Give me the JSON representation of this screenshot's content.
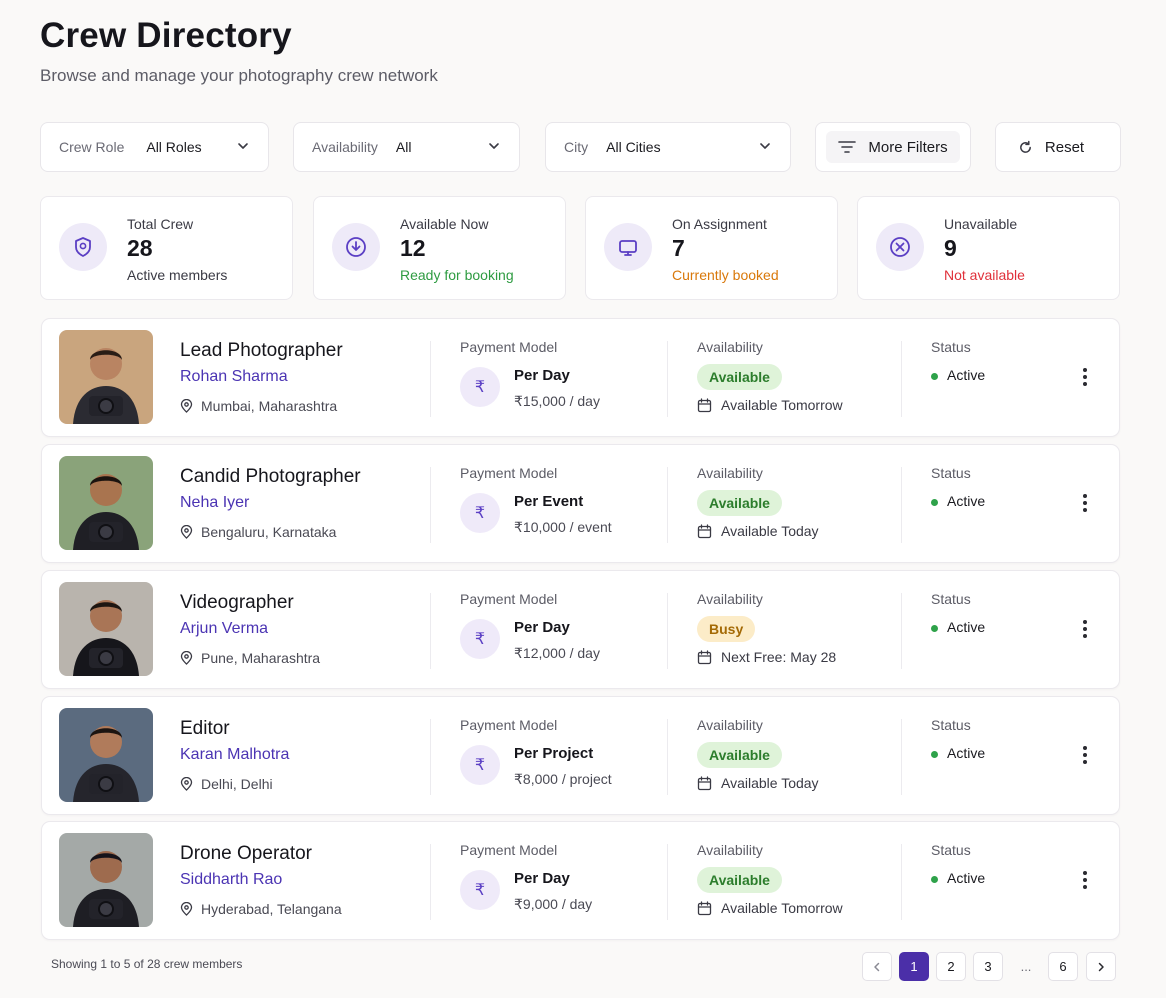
{
  "header": {
    "title": "Crew Directory",
    "subtitle": "Browse and manage your photography crew network"
  },
  "filters": {
    "role": {
      "label": "Crew Role",
      "value": "All Roles"
    },
    "availability": {
      "label": "Availability",
      "value": "All"
    },
    "city": {
      "label": "City",
      "value": "All Cities"
    },
    "more_filters_label": "More Filters",
    "reset_label": "Reset"
  },
  "stats": [
    {
      "label": "Total Crew",
      "value": "28",
      "sub": "Active members",
      "sub_color": "#3a3a44",
      "icon": "badge-icon"
    },
    {
      "label": "Available Now",
      "value": "12",
      "sub": "Ready for booking",
      "sub_color": "#2e9b41",
      "icon": "download-circle-icon"
    },
    {
      "label": "On Assignment",
      "value": "7",
      "sub": "Currently booked",
      "sub_color": "#d9780a",
      "icon": "monitor-icon"
    },
    {
      "label": "Unavailable",
      "value": "9",
      "sub": "Not available",
      "sub_color": "#e0303a",
      "icon": "x-circle-icon"
    }
  ],
  "columns": {
    "payment": "Payment Model",
    "availability": "Availability",
    "status": "Status"
  },
  "crew": [
    {
      "role": "Lead Photographer",
      "name": "Rohan Sharma",
      "location": "Mumbai, Maharashtra",
      "payment_model": "Per Day",
      "rate": "₹15,000 / day",
      "availability": "Available",
      "availability_kind": "green",
      "availability_note": "Available Tomorrow",
      "status": "Active"
    },
    {
      "role": "Candid Photographer",
      "name": "Neha Iyer",
      "location": "Bengaluru, Karnataka",
      "payment_model": "Per Event",
      "rate": "₹10,000 / event",
      "availability": "Available",
      "availability_kind": "green",
      "availability_note": "Available Today",
      "status": "Active"
    },
    {
      "role": "Videographer",
      "name": "Arjun Verma",
      "location": "Pune, Maharashtra",
      "payment_model": "Per Day",
      "rate": "₹12,000 / day",
      "availability": "Busy",
      "availability_kind": "amber",
      "availability_note": "Next Free: May 28",
      "status": "Active"
    },
    {
      "role": "Editor",
      "name": "Karan Malhotra",
      "location": "Delhi, Delhi",
      "payment_model": "Per Project",
      "rate": "₹8,000 / project",
      "availability": "Available",
      "availability_kind": "green",
      "availability_note": "Available Today",
      "status": "Active"
    },
    {
      "role": "Drone Operator",
      "name": "Siddharth Rao",
      "location": "Hyderabad, Telangana",
      "payment_model": "Per Day",
      "rate": "₹9,000 / day",
      "availability": "Available",
      "availability_kind": "green",
      "availability_note": "Available Tomorrow",
      "status": "Active"
    }
  ],
  "footer": {
    "showing": "Showing 1 to 5 of 28 crew members",
    "pages": [
      "1",
      "2",
      "3",
      "...",
      "6"
    ],
    "current_page": "1"
  },
  "colors": {
    "accent": "#4b2fa8",
    "available_bg": "#dff3d9",
    "busy_bg": "#fcecc8",
    "active_dot": "#2ea24a"
  }
}
